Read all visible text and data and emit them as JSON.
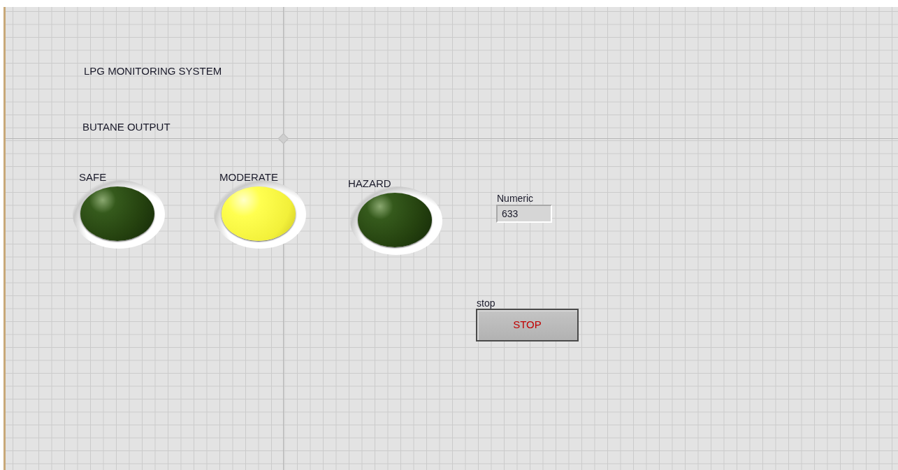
{
  "title": "LPG MONITORING SYSTEM",
  "subtitle": "BUTANE OUTPUT",
  "leds": [
    {
      "label": "SAFE",
      "on": false
    },
    {
      "label": "MODERATE",
      "on": true
    },
    {
      "label": "HAZARD",
      "on": false
    }
  ],
  "numeric": {
    "label": "Numeric",
    "value": "633"
  },
  "stop_button": {
    "label": "stop",
    "text": "STOP"
  }
}
